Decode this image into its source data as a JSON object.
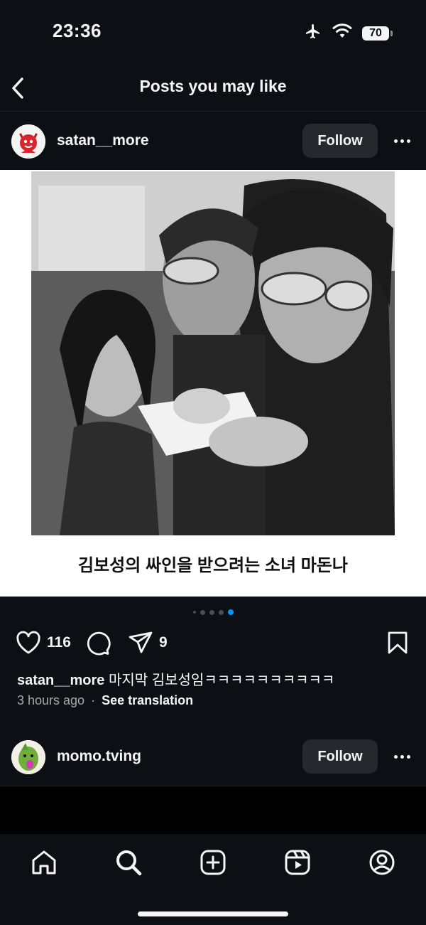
{
  "status_bar": {
    "time": "23:36",
    "battery": "70"
  },
  "header": {
    "title": "Posts you may like"
  },
  "post1": {
    "username": "satan__more",
    "follow_label": "Follow",
    "image_caption": "김보성의 싸인을 받으려는 소녀 마돈나",
    "carousel": {
      "count": 5,
      "active_index": 4
    },
    "likes": "116",
    "shares": "9",
    "caption_user": "satan__more",
    "caption_text": "마지막 김보성임ㅋㅋㅋㅋㅋㅋㅋㅋㅋㅋ",
    "time_ago": "3 hours ago",
    "separator": "·",
    "see_translation": "See translation"
  },
  "post2": {
    "username": "momo.tving",
    "follow_label": "Follow"
  },
  "colors": {
    "background": "#0c1014",
    "accent": "#0095f6",
    "button_bg": "#25292e"
  },
  "icons": {
    "status": [
      "airplane-icon",
      "wifi-icon",
      "battery-icon"
    ],
    "actions": [
      "heart-icon",
      "comment-icon",
      "share-icon",
      "bookmark-icon"
    ],
    "tabs": [
      "home-icon",
      "search-icon",
      "create-icon",
      "reels-icon",
      "profile-icon"
    ]
  }
}
